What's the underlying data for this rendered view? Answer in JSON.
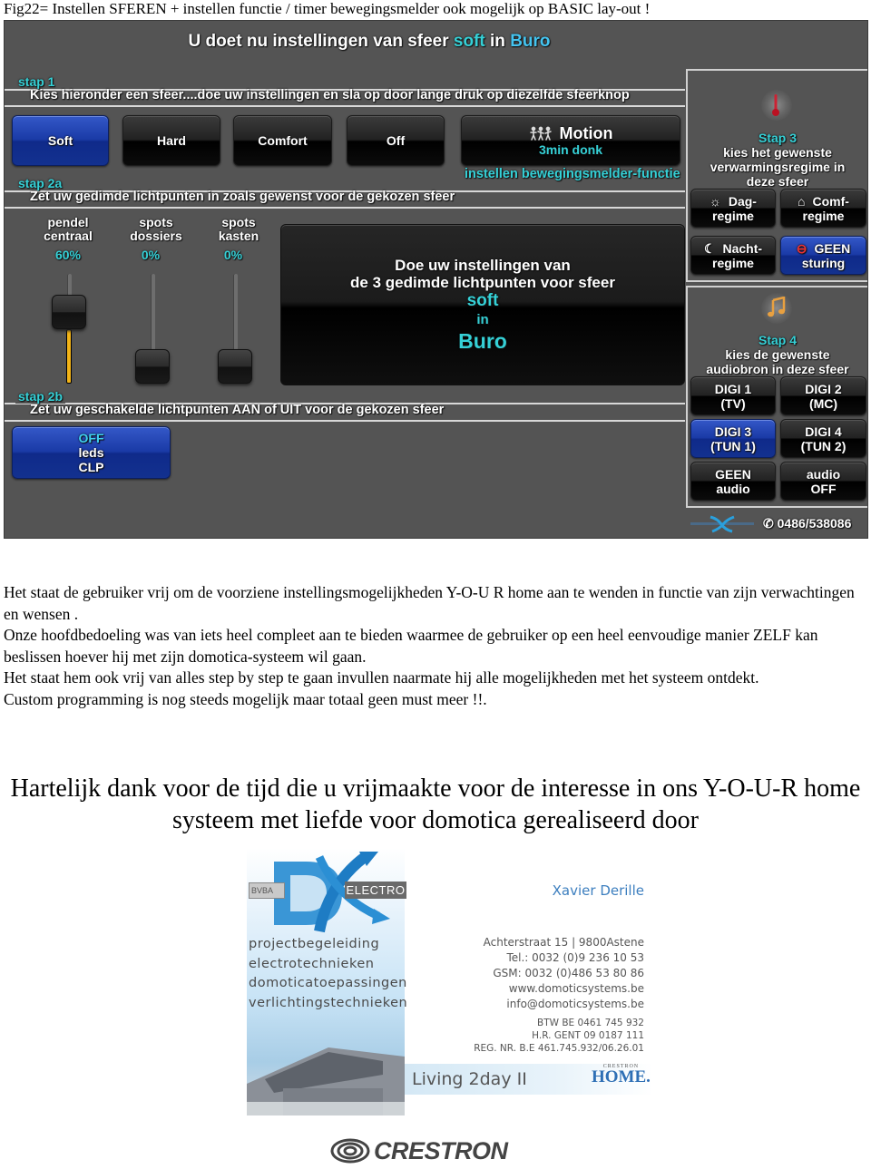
{
  "figure_caption": "Fig22= Instellen SFEREN + instellen functie / timer bewegingsmelder ook mogelijk op BASIC lay-out !",
  "screen": {
    "title": {
      "prefix": "U doet nu instellingen van sfeer",
      "sfeer": "soft",
      "in": "in",
      "room": "Buro"
    },
    "step1": {
      "tag": "stap 1",
      "description": "Kies hieronder een sfeer....doe uw instellingen en sla op door lange druk op diezelfde sfeerknop",
      "scenes": [
        {
          "label": "Soft",
          "active": true
        },
        {
          "label": "Hard",
          "active": false
        },
        {
          "label": "Comfort",
          "active": false
        },
        {
          "label": "Off",
          "active": false
        }
      ],
      "motion": {
        "icon": "motion-people-icon",
        "title": "Motion",
        "subtitle": "3min donk",
        "caption": "instellen bewegingsmelder-functie"
      }
    },
    "step2a": {
      "tag": "stap 2a",
      "description": "Zet uw gedimde lichtpunten in zoals gewenst voor de gekozen sfeer",
      "faders": [
        {
          "label_line1": "pendel",
          "label_line2": "centraal",
          "value_text": "60%",
          "level": 0.6
        },
        {
          "label_line1": "spots",
          "label_line2": "dossiers",
          "value_text": "0%",
          "level": 0.0
        },
        {
          "label_line1": "spots",
          "label_line2": "kasten",
          "value_text": "0%",
          "level": 0.0
        }
      ],
      "info": {
        "line1": "Doe uw instellingen van",
        "line2": "de 3 gedimde lichtpunten voor sfeer",
        "sfeer": "soft",
        "in": "in",
        "room": "Buro"
      }
    },
    "step2b": {
      "tag": "stap 2b",
      "description": "Zet uw geschakelde lichtpunten AAN of UIT voor de gekozen sfeer",
      "toggle": {
        "state": "OFF",
        "line2": "leds",
        "line3": "CLP",
        "active": true
      }
    },
    "step3": {
      "icon": "thermometer-icon",
      "tag": "Stap 3",
      "line1": "kies het gewenste",
      "line2": "verwarmingsregime in",
      "line3": "deze sfeer",
      "buttons": [
        {
          "icon": "sun-icon",
          "glyph": "☼",
          "line1": "Dag-",
          "line2": "regime",
          "active": false
        },
        {
          "icon": "home-icon",
          "glyph": "⌂",
          "line1": "Comf-",
          "line2": "regime",
          "active": false
        },
        {
          "icon": "moon-icon",
          "glyph": "☾",
          "line1": "Nacht-",
          "line2": "regime",
          "active": false
        },
        {
          "icon": "no-entry-icon",
          "glyph": "⊖",
          "line1": "GEEN",
          "line2": "sturing",
          "active": true
        }
      ]
    },
    "step4": {
      "icon": "music-note-icon",
      "tag": "Stap 4",
      "line1": "kies de gewenste",
      "line2": "audiobron in deze sfeer",
      "buttons": [
        {
          "line1": "DIGI 1",
          "line2": "(TV)",
          "active": false
        },
        {
          "line1": "DIGI 2",
          "line2": "(MC)",
          "active": false
        },
        {
          "line1": "DIGI 3",
          "line2": "(TUN 1)",
          "active": true
        },
        {
          "line1": "DIGI 4",
          "line2": "(TUN 2)",
          "active": false
        },
        {
          "line1": "GEEN",
          "line2": "audio",
          "active": false
        },
        {
          "line1": "audio",
          "line2": "OFF",
          "active": false
        }
      ]
    },
    "footer": {
      "logo": "dx-logo",
      "phone_icon": "phone-icon",
      "phone": "0486/538086"
    },
    "colors": {
      "accent_cyan": "#35d0d6",
      "active_blue": "#1a3aa6",
      "panel_gray": "#545454",
      "fader_fill": "#f3b418"
    }
  },
  "paragraphs": [
    "Het staat de gebruiker vrij om de voorziene instellingsmogelijkheden Y-O-U R home aan te wenden in functie van zijn verwachtingen en wensen .",
    "Onze hoofdbedoeling was van iets heel compleet aan te bieden waarmee de gebruiker op een heel eenvoudige manier ZELF kan beslissen hoever hij met zijn domotica-systeem wil gaan.",
    "Het staat hem ook vrij van alles step by step te gaan invullen naarmate hij alle mogelijkheden met het systeem ontdekt.",
    "Custom programming is nog steeds mogelijk maar totaal geen must meer !!."
  ],
  "thanks": "Hartelijk dank voor de tijd die u vrijmaakte voor de interesse in ons Y-O-U-R home systeem met liefde voor domotica gerealiseerd door",
  "card": {
    "bvba": "BVBA",
    "electro": "ELECTRO",
    "services": [
      "projectbegeleiding",
      "electrotechnieken",
      "domoticatoepassingen",
      "verlichtingstechnieken"
    ],
    "name": "Xavier Derille",
    "address": [
      "Achterstraat 15 | 9800Astene",
      "Tel.: 0032 (0)9 236 10 53",
      "GSM: 0032 (0)486 53 80 86",
      "www.domoticsystems.be",
      "info@domoticsystems.be"
    ],
    "legal": [
      "BTW BE 0461 745 932",
      "H.R. GENT 09 0187 111",
      "REG. NR. B.E 461.745.932/06.26.01"
    ],
    "living": "Living 2day II",
    "crestron_home_small": "CRESTRON",
    "crestron_home_big": "HOME."
  },
  "crestron_logo": "CRESTRON"
}
